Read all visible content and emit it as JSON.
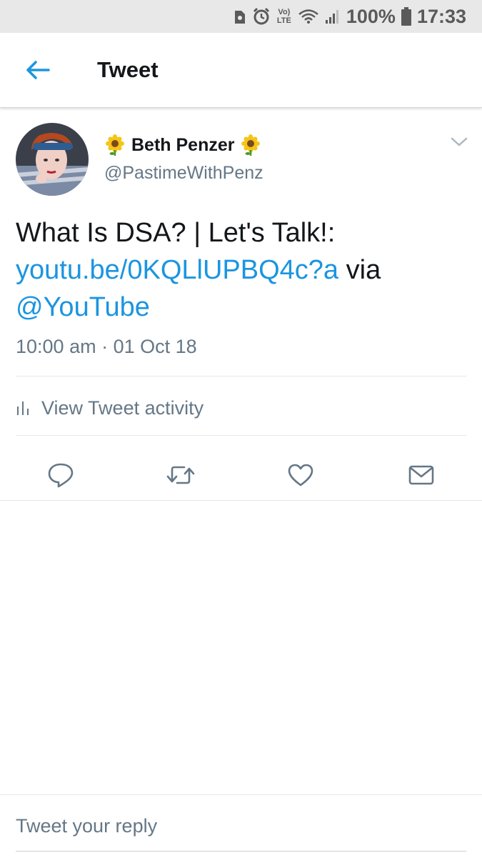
{
  "status_bar": {
    "battery": "100%",
    "time": "17:33",
    "lte_label": "Vo) LTE"
  },
  "header": {
    "title": "Tweet"
  },
  "tweet": {
    "author_name": "Beth Penzer",
    "author_emoji": "🌻",
    "author_handle": "@PastimeWithPenz",
    "text_plain": "What Is DSA? | Let's Talk!:",
    "text_link": "youtu.be/0KQLlUPBQ4c?a",
    "text_via": " via",
    "text_mention": "@YouTube",
    "timestamp": "10:00 am · 01 Oct 18",
    "activity_label": "View Tweet activity"
  },
  "reply": {
    "placeholder": "Tweet your reply"
  },
  "colors": {
    "accent": "#1b95e0",
    "text": "#14171a",
    "muted": "#657786"
  },
  "icons": [
    "back-arrow-icon",
    "chevron-down-icon",
    "analytics-icon",
    "reply-icon",
    "retweet-icon",
    "like-icon",
    "direct-message-icon"
  ]
}
